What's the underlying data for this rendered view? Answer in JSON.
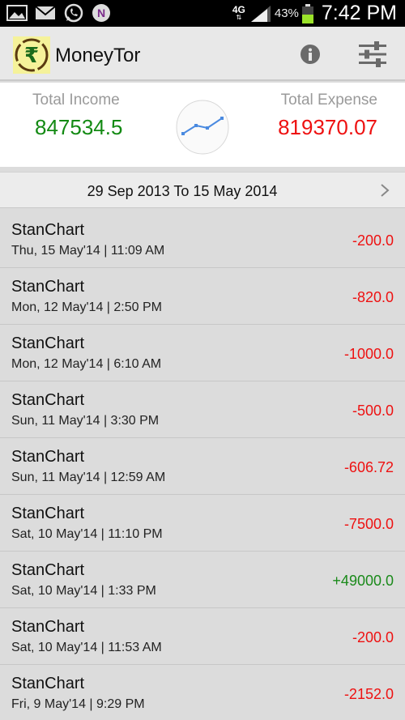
{
  "status_bar": {
    "icons": [
      "gallery-icon",
      "mail-icon",
      "whatsapp-icon",
      "notification-app-icon"
    ],
    "network": "4G",
    "battery_percent": "43%",
    "time": "7:42 PM"
  },
  "app_bar": {
    "title": "MoneyTor",
    "logo_icon": "rupee-logo-icon",
    "actions": [
      "info-icon",
      "settings-sliders-icon"
    ]
  },
  "summary": {
    "income_label": "Total Income",
    "income_value": "847534.5",
    "expense_label": "Total Expense",
    "expense_value": "819370.07",
    "income_color": "#138a13",
    "expense_color": "#ee1111"
  },
  "date_range": {
    "text": "29 Sep 2013 To 15 May 2014"
  },
  "transactions": [
    {
      "name": "StanChart",
      "date": "Thu, 15 May'14 | 11:09 AM",
      "amount": "-200.0",
      "type": "debit"
    },
    {
      "name": "StanChart",
      "date": "Mon, 12 May'14 | 2:50 PM",
      "amount": "-820.0",
      "type": "debit"
    },
    {
      "name": "StanChart",
      "date": "Mon, 12 May'14 | 6:10 AM",
      "amount": "-1000.0",
      "type": "debit"
    },
    {
      "name": "StanChart",
      "date": "Sun, 11 May'14 | 3:30 PM",
      "amount": "-500.0",
      "type": "debit"
    },
    {
      "name": "StanChart",
      "date": "Sun, 11 May'14 | 12:59 AM",
      "amount": "-606.72",
      "type": "debit"
    },
    {
      "name": "StanChart",
      "date": "Sat, 10 May'14 | 11:10 PM",
      "amount": "-7500.0",
      "type": "debit"
    },
    {
      "name": "StanChart",
      "date": "Sat, 10 May'14 | 1:33 PM",
      "amount": "+49000.0",
      "type": "credit"
    },
    {
      "name": "StanChart",
      "date": "Sat, 10 May'14 | 11:53 AM",
      "amount": "-200.0",
      "type": "debit"
    },
    {
      "name": "StanChart",
      "date": "Fri, 9 May'14 | 9:29 PM",
      "amount": "-2152.0",
      "type": "debit"
    }
  ],
  "colors": {
    "debit": "#ee1111",
    "credit": "#1a8a1a"
  }
}
